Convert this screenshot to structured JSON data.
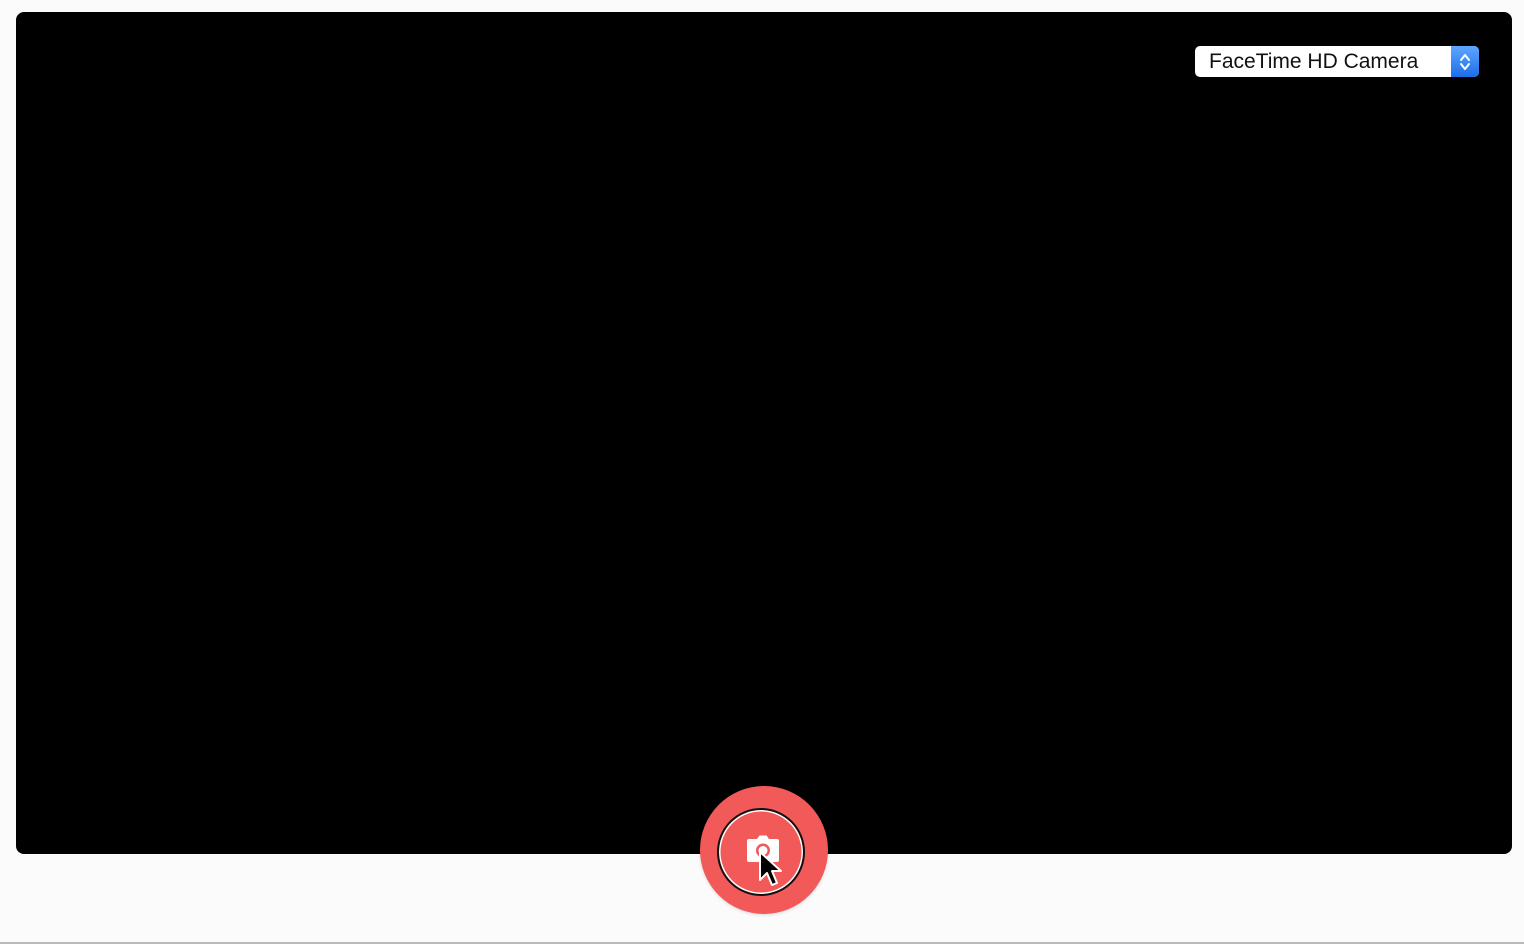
{
  "camera_select": {
    "selected": "FaceTime HD Camera",
    "icon": "select-arrows-icon",
    "accent_color": "#1b6fe8"
  },
  "viewport": {
    "background": "#000000"
  },
  "shutter": {
    "icon": "camera-icon",
    "color": "#f25a5a"
  },
  "cursor": {
    "icon": "mouse-pointer-icon"
  }
}
